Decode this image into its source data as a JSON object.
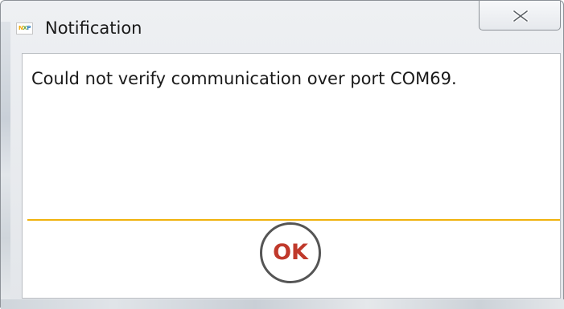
{
  "window": {
    "title": "Notification",
    "icon": "nxp-logo-icon",
    "close_icon": "close-icon"
  },
  "dialog": {
    "message": "Could not verify communication over port COM69.",
    "ok_label": "OK"
  },
  "colors": {
    "divider": "#f0b20c",
    "ok_text": "#c0392b",
    "ok_border": "#555555"
  }
}
